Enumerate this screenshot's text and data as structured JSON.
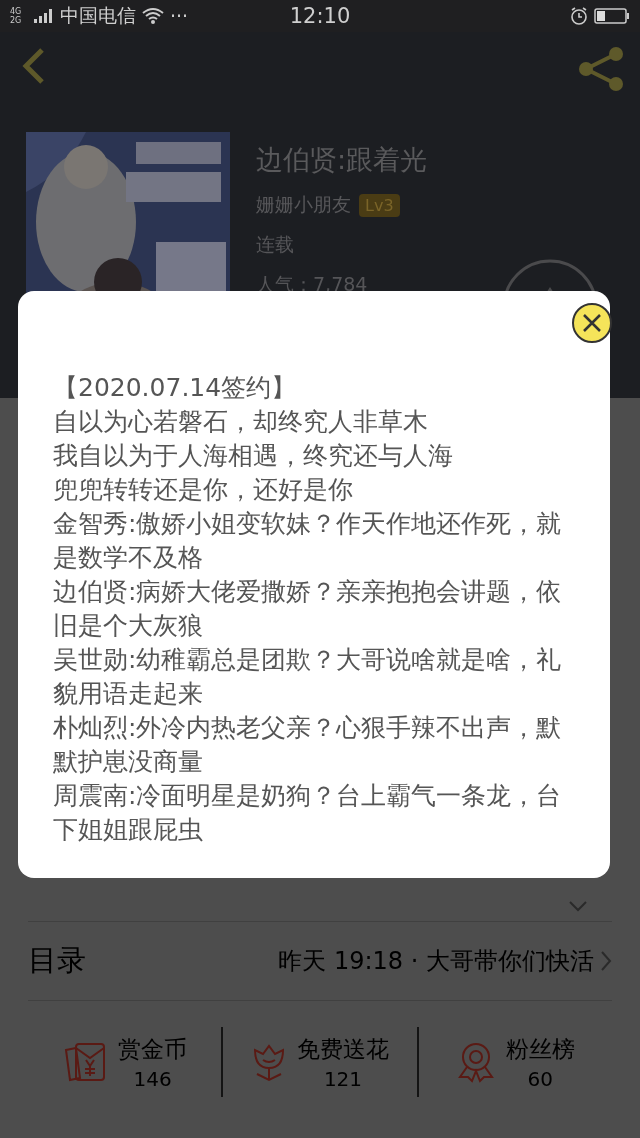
{
  "status_bar": {
    "network": "4G 2G",
    "carrier": "中国电信",
    "more": "···",
    "time": "12:10"
  },
  "book": {
    "title": "边伯贤:跟着光",
    "author": "姗姗小朋友",
    "level": "Lv3",
    "status": "连载",
    "popularity": "人气：7,784"
  },
  "catalog": {
    "label": "目录",
    "latest": "昨天 19:18 · 大哥带你们快活"
  },
  "stats": [
    {
      "kind": "coin",
      "label": "赏金币",
      "count": "146"
    },
    {
      "kind": "flower",
      "label": "免费送花",
      "count": "121"
    },
    {
      "kind": "rank",
      "label": "粉丝榜",
      "count": "60"
    }
  ],
  "dialog": {
    "paragraphs": [
      "【2020.07.14签约】",
      "自以为心若磐石，却终究人非草木",
      "我自以为于人海相遇，终究还与人海",
      "兜兜转转还是你，还好是你",
      "金智秀:傲娇小姐变软妹？作天作地还作死，就是数学不及格",
      "边伯贤:病娇大佬爱撒娇？亲亲抱抱会讲题，依旧是个大灰狼",
      "吴世勋:幼稚霸总是团欺？大哥说啥就是啥，礼貌用语走起来",
      "朴灿烈:外冷内热老父亲？心狠手辣不出声，默默护崽没商量",
      "周震南:冷面明星是奶狗？台上霸气一条龙，台下姐姐跟屁虫"
    ]
  }
}
